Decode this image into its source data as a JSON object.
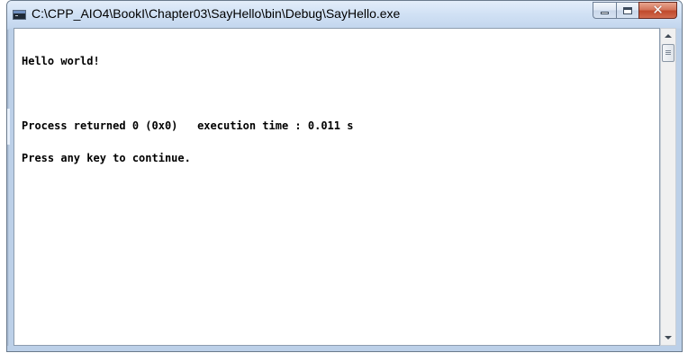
{
  "window": {
    "title": "C:\\CPP_AIO4\\BookI\\Chapter03\\SayHello\\bin\\Debug\\SayHello.exe",
    "app_icon": "console-window-icon",
    "buttons": {
      "minimize_icon": "minimize-icon",
      "maximize_icon": "maximize-icon",
      "close_icon": "close-icon",
      "close_glyph": "✕"
    },
    "colors": {
      "title_bar": "#d2e2f5",
      "close_button": "#c0492c",
      "console_background": "#ffffff",
      "console_text": "#000000"
    }
  },
  "console": {
    "lines": [
      "Hello world!",
      "",
      "Process returned 0 (0x0)   execution time : 0.011 s",
      "Press any key to continue."
    ]
  },
  "scrollbar": {
    "up_icon": "scroll-up-arrow-icon",
    "down_icon": "scroll-down-arrow-icon"
  }
}
